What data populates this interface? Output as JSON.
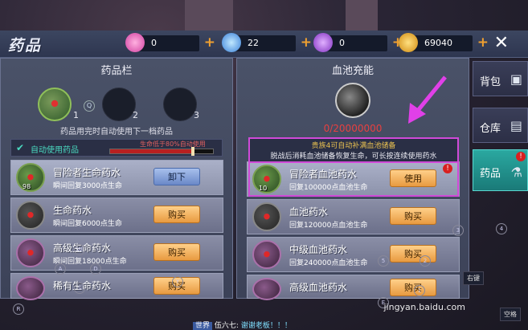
{
  "header": {
    "title": "药品",
    "currencies": [
      {
        "icon": "pink-diamond-icon",
        "value": "0",
        "color": "#f070c0"
      },
      {
        "icon": "blue-diamond-icon",
        "value": "22",
        "color": "#5aa8f0"
      },
      {
        "icon": "purple-crystal-icon",
        "value": "0",
        "color": "#b060e0"
      },
      {
        "icon": "gold-coin-icon",
        "value": "69040",
        "color": "#f0b030"
      }
    ],
    "plus": "+",
    "close": "✕"
  },
  "left": {
    "title": "药品栏",
    "slots": [
      "1",
      "2",
      "3"
    ],
    "q_key": "Q",
    "hint": "药品用完时自动使用下一档药品",
    "auto": {
      "label": "自动使用药品",
      "condition": "生命低于80%自动使用",
      "level": 0.8
    },
    "items": [
      {
        "name": "冒险者生命药水",
        "desc": "瞬间回复3000点生命",
        "count": "98",
        "button": "卸下"
      },
      {
        "name": "生命药水",
        "desc": "瞬间回复6000点生命",
        "count": "",
        "button": "购买"
      },
      {
        "name": "高级生命药水",
        "desc": "瞬间回复18000点生命",
        "count": "",
        "button": "购买"
      },
      {
        "name": "稀有生命药水",
        "desc": "",
        "count": "",
        "button": "购买"
      }
    ]
  },
  "right": {
    "title": "血池充能",
    "pool_value": "0/20000000",
    "notice_top": "贵族4可自动补满血池储备",
    "notice_bottom": "脱战后消耗血池储备恢复生命，可长按连续使用药水",
    "items": [
      {
        "name": "冒险者血池药水",
        "desc": "回复100000点血池生命",
        "count": "10",
        "button": "使用",
        "alert": "!"
      },
      {
        "name": "血池药水",
        "desc": "回复120000点血池生命",
        "count": "",
        "button": "购买"
      },
      {
        "name": "中级血池药水",
        "desc": "回复240000点血池生命",
        "count": "",
        "button": "购买"
      },
      {
        "name": "高级血池药水",
        "desc": "",
        "count": "",
        "button": "购买"
      }
    ]
  },
  "tabs": [
    {
      "label": "背包",
      "icon": "backpack-icon"
    },
    {
      "label": "仓库",
      "icon": "storage-icon"
    },
    {
      "label": "药品",
      "icon": "flask-icon",
      "alert": "!"
    }
  ],
  "keys": {
    "w": "W",
    "a": "A",
    "s": "S",
    "d": "D",
    "y": "Y",
    "e": "E",
    "r": "R",
    "n3": "3",
    "n4": "4",
    "n2": "2",
    "n5": "5",
    "n1": "1",
    "right_key": "右键",
    "space": "空格"
  },
  "chat": {
    "channel": "世界",
    "user": "伍六七:",
    "message": "谢谢老板！！！"
  },
  "watermark": "jingyan.baidu.com"
}
